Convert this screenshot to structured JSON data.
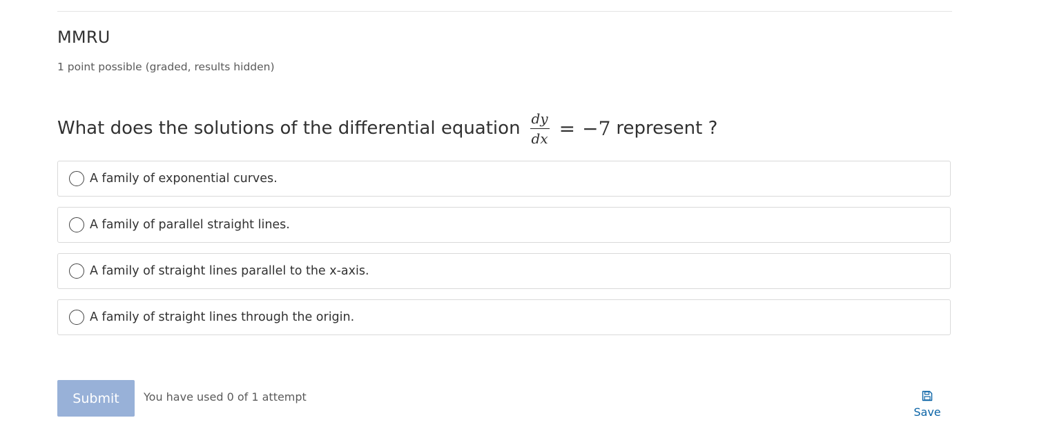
{
  "problem": {
    "title": "MMRU",
    "meta": "1 point possible (graded, results hidden)"
  },
  "question": {
    "text_before": "What does the solutions of the differential equation",
    "math": {
      "numerator": "dy",
      "denominator": "dx",
      "equals": "=",
      "rhs": "−7"
    },
    "text_after": "represent ?"
  },
  "choices": [
    {
      "label": "A family of exponential curves.",
      "selected": false
    },
    {
      "label": "A family of parallel straight lines.",
      "selected": false
    },
    {
      "label": "A family of straight lines parallel to the x-axis.",
      "selected": false
    },
    {
      "label": "A family of straight lines through the origin.",
      "selected": false
    }
  ],
  "actions": {
    "submit_label": "Submit",
    "attempts_text": "You have used 0 of 1 attempt",
    "save_label": "Save",
    "save_icon": "floppy-disk-icon"
  },
  "colors": {
    "submit_bg": "#98b1d8",
    "link": "#0a63a6",
    "border": "#d9d9d9"
  }
}
